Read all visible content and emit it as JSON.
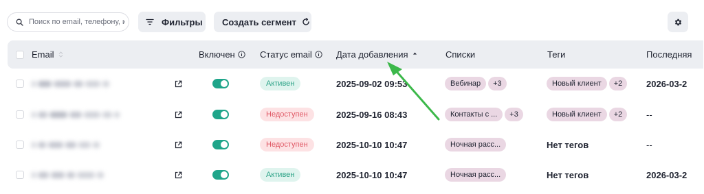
{
  "toolbar": {
    "search_placeholder": "Поиск по email, телефону, и",
    "filters_label": "Фильтры",
    "create_segment_label": "Создать сегмент"
  },
  "table": {
    "columns": {
      "email": "Email",
      "enabled": "Включен",
      "email_status": "Статус email",
      "date_added": "Дата добавления",
      "lists": "Списки",
      "tags": "Теги",
      "last": "Последняя"
    },
    "rows": [
      {
        "enabled": true,
        "status": "Активен",
        "status_kind": "active",
        "date_added": "2025-09-02 09:53",
        "lists": [
          "Вебинар"
        ],
        "lists_more": "+3",
        "tags": [
          "Новый клиент"
        ],
        "tags_more": "+2",
        "tags_empty": "",
        "last": "2026-03-2"
      },
      {
        "enabled": true,
        "status": "Недоступен",
        "status_kind": "unavailable",
        "date_added": "2025-09-16 08:43",
        "lists": [
          "Контакты с ..."
        ],
        "lists_more": "+3",
        "tags": [
          "Новый клиент"
        ],
        "tags_more": "+2",
        "tags_empty": "",
        "last": "--"
      },
      {
        "enabled": true,
        "status": "Недоступен",
        "status_kind": "unavailable",
        "date_added": "2025-10-10 10:47",
        "lists": [
          "Ночная расс..."
        ],
        "lists_more": "",
        "tags": [],
        "tags_more": "",
        "tags_empty": "Нет тегов",
        "last": "--"
      },
      {
        "enabled": true,
        "status": "Активен",
        "status_kind": "active",
        "date_added": "2025-10-10 10:47",
        "lists": [
          "Ночная расс..."
        ],
        "lists_more": "",
        "tags": [],
        "tags_more": "",
        "tags_empty": "Нет тегов",
        "last": "2026-03-2"
      }
    ]
  },
  "icons": {
    "search": "search-icon",
    "filters": "filter-icon",
    "segment": "refresh-icon",
    "settings": "gear-icon",
    "info": "info-icon",
    "sort": "sort-asc-icon",
    "external": "external-link-icon"
  },
  "colors": {
    "toggle_on": "#1fa58a",
    "active_text": "#2aa286",
    "active_bg": "#dff4ee",
    "unavailable_text": "#e05865",
    "unavailable_bg": "#fde2e4",
    "tag_bg": "#ead7e3",
    "annotation_arrow": "#3cb84a"
  }
}
